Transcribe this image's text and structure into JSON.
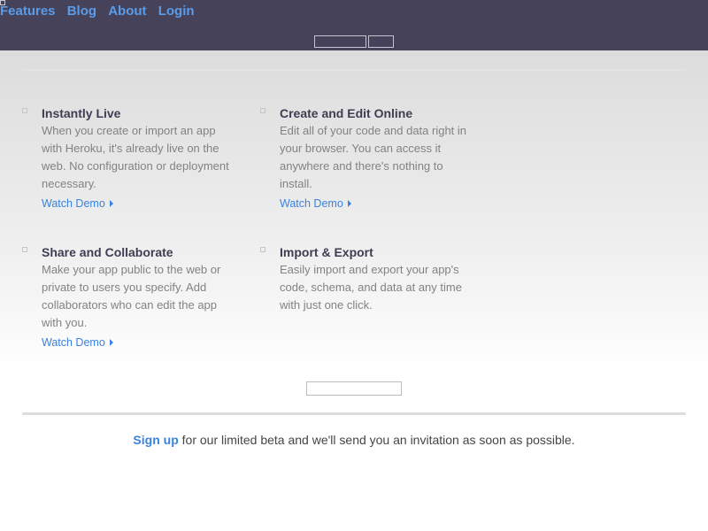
{
  "header": {
    "nav": [
      "Features",
      "Blog",
      "About",
      "Login"
    ],
    "colors": {
      "background": "#45425a",
      "link": "#5b9be8"
    }
  },
  "features": [
    {
      "title": "Instantly Live",
      "description": "When you create or import an app with Heroku, it's already live on the web. No configuration or deployment necessary.",
      "link": "Watch Demo"
    },
    {
      "title": "Create and Edit Online",
      "description": "Edit all of your code and data right in your browser. You can access it anywhere and there's nothing to install.",
      "link": "Watch Demo"
    },
    {
      "title": "Share and Collaborate",
      "description": "Make your app public to the web or private to users you specify. Add collaborators who can edit the app with you.",
      "link": "Watch Demo"
    },
    {
      "title": "Import & Export",
      "description": "Easily import and export your app's code, schema, and data at any time with just one click."
    }
  ],
  "signup": {
    "link": "Sign up",
    "text": " for our limited beta and we'll send you an invitation as soon as possible."
  },
  "icons": {
    "bullet": "square-bullet-icon",
    "demo": "play-arrow-icon"
  }
}
